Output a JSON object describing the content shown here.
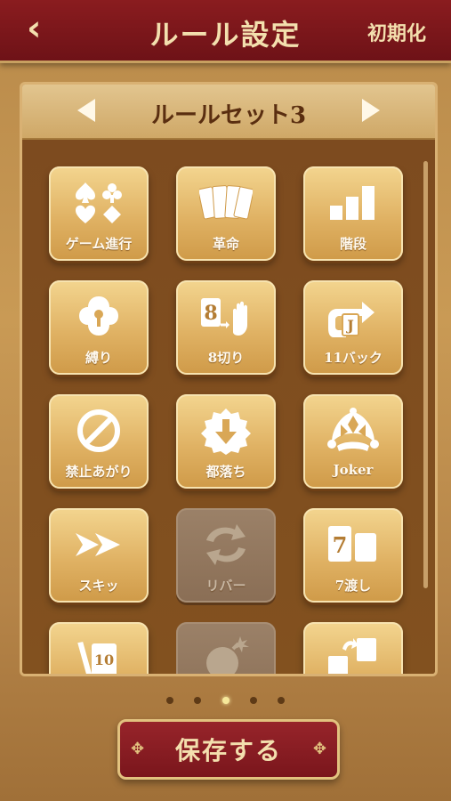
{
  "header": {
    "back_icon": "chevron-left-icon",
    "title": "ルール設定",
    "reset_label": "初期化"
  },
  "rule_set": {
    "name": "ルールセット3",
    "prev_icon": "triangle-left-icon",
    "next_icon": "triangle-right-icon"
  },
  "rules": [
    {
      "label": "ゲーム進行",
      "icon": "card-suits-icon",
      "enabled": true
    },
    {
      "label": "革命",
      "icon": "cards-fan-icon",
      "enabled": true
    },
    {
      "label": "階段",
      "icon": "stairs-icon",
      "enabled": true
    },
    {
      "label": "縛り",
      "icon": "lock-icon",
      "enabled": true
    },
    {
      "label": "8切り",
      "icon": "eight-stop-hand-icon",
      "enabled": true
    },
    {
      "label": "11バック",
      "icon": "jack-back-arrow-icon",
      "enabled": true
    },
    {
      "label": "禁止あがり",
      "icon": "prohibited-icon",
      "enabled": true
    },
    {
      "label": "都落ち",
      "icon": "down-arrow-badge-icon",
      "enabled": true
    },
    {
      "label": "Joker",
      "icon": "jester-hat-icon",
      "enabled": true
    },
    {
      "label": "スキッ",
      "icon": "double-chevron-right-icon",
      "enabled": true
    },
    {
      "label": "リバー",
      "icon": "reverse-arrows-icon",
      "enabled": false
    },
    {
      "label": "7渡し",
      "icon": "seven-pass-card-icon",
      "enabled": true
    },
    {
      "label": "",
      "icon": "ten-discard-card-icon",
      "enabled": true
    },
    {
      "label": "",
      "icon": "bomb-icon",
      "enabled": false
    },
    {
      "label": "",
      "icon": "card-exchange-icon",
      "enabled": true
    }
  ],
  "pagination": {
    "count": 5,
    "active": 3
  },
  "save": {
    "label": "保存する"
  },
  "colors": {
    "header_red": "#8a1c1f",
    "gold": "#e0b264",
    "cream": "#f3dfae",
    "panel_brown": "#7d4b1f"
  }
}
